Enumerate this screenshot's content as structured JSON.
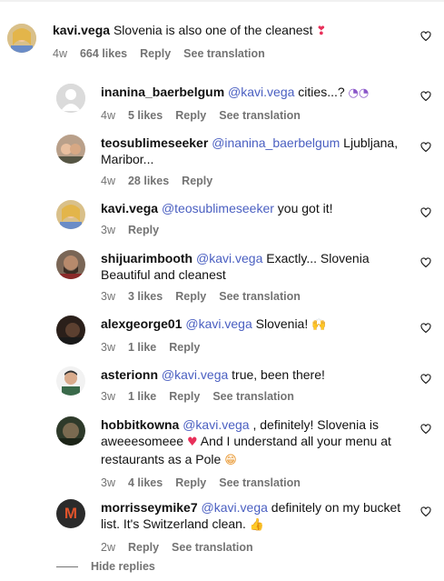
{
  "comments": [
    {
      "user": "kavi.vega",
      "text": "Slovenia is also one of the cleanest",
      "emoji": "❣",
      "time": "4w",
      "likes": "664 likes",
      "reply": "Reply",
      "translate": "See translation"
    },
    {
      "user": "inanina_baerbelgum",
      "mention": "@kavi.vega",
      "text": "cities...?",
      "emoji": "◔◔",
      "time": "4w",
      "likes": "5 likes",
      "reply": "Reply",
      "translate": "See translation"
    },
    {
      "user": "teosublimeseeker",
      "mention": "@inanina_baerbelgum",
      "text": "Ljubljana,",
      "text2": "Maribor...",
      "time": "4w",
      "likes": "28 likes",
      "reply": "Reply"
    },
    {
      "user": "kavi.vega",
      "mention": "@teosublimeseeker",
      "text": "you got it!",
      "time": "3w",
      "reply": "Reply"
    },
    {
      "user": "shijuarimbooth",
      "mention": "@kavi.vega",
      "text": "Exactly... Slovenia",
      "text2": "Beautiful and cleanest",
      "time": "3w",
      "likes": "3 likes",
      "reply": "Reply",
      "translate": "See translation"
    },
    {
      "user": "alexgeorge01",
      "mention": "@kavi.vega",
      "text": "Slovenia!",
      "emoji": "🙌",
      "time": "3w",
      "likes": "1 like",
      "reply": "Reply"
    },
    {
      "user": "asterionn",
      "mention": "@kavi.vega",
      "text": "true, been there!",
      "time": "3w",
      "likes": "1 like",
      "reply": "Reply",
      "translate": "See translation"
    },
    {
      "user": "hobbitkowna",
      "mention": "@kavi.vega",
      "text": ", definitely! Slovenia is",
      "text2": "aweeesomeee",
      "emoji2": "♥",
      "text2b": "And I understand all your menu at",
      "text3": "restaurants as a Pole",
      "emoji3": "😁",
      "time": "3w",
      "likes": "4 likes",
      "reply": "Reply",
      "translate": "See translation"
    },
    {
      "user": "morrisseymike7",
      "avatar_letter": "M",
      "mention": "@kavi.vega",
      "text": "definitely on my bucket",
      "text2": "list. It's Switzerland clean.",
      "emoji2": "👍",
      "time": "2w",
      "reply": "Reply",
      "translate": "See translation"
    }
  ],
  "hide_replies": "Hide replies",
  "colors": {
    "mention": "#4a5fc1",
    "meta": "#737373",
    "heart_emoji": "#e8305a",
    "m_avatar_bg": "#2b2b2b",
    "m_avatar_letter": "#e0532b"
  }
}
